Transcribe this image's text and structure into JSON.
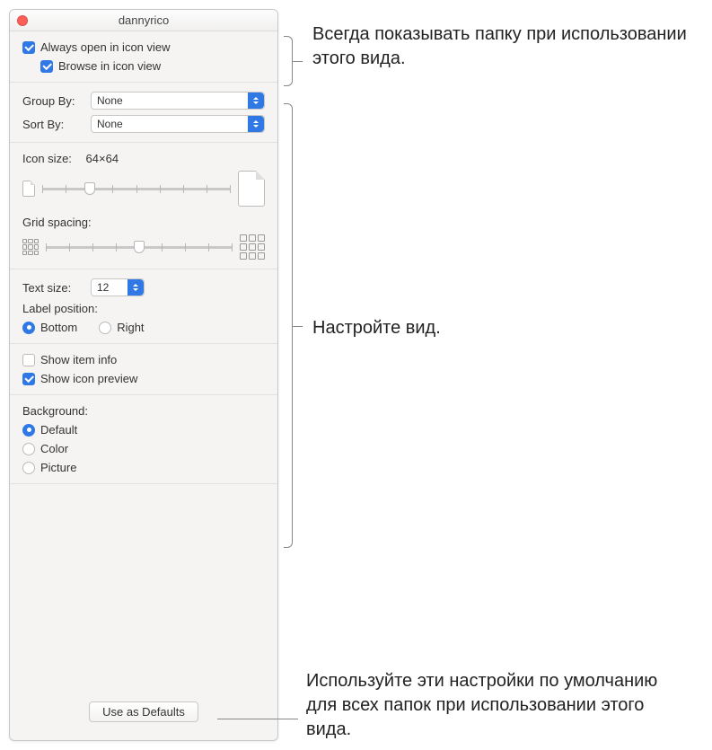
{
  "window": {
    "title": "dannyrico"
  },
  "view": {
    "always_open": "Always open in icon view",
    "browse": "Browse in icon view"
  },
  "group_sort": {
    "group_label": "Group By:",
    "group_value": "None",
    "sort_label": "Sort By:",
    "sort_value": "None"
  },
  "icon_size": {
    "label": "Icon size:",
    "value": "64×64"
  },
  "grid_spacing": {
    "label": "Grid spacing:"
  },
  "text": {
    "size_label": "Text size:",
    "size_value": "12",
    "label_position": "Label position:",
    "bottom": "Bottom",
    "right": "Right"
  },
  "info": {
    "show_item": "Show item info",
    "show_preview": "Show icon preview"
  },
  "background": {
    "heading": "Background:",
    "default": "Default",
    "color": "Color",
    "picture": "Picture"
  },
  "footer": {
    "btn": "Use as Defaults"
  },
  "annotations": {
    "top": "Всегда показывать папку при использовании этого вида.",
    "mid": "Настройте вид.",
    "bottom": "Используйте эти настройки по умолчанию для всех папок при использовании этого вида."
  }
}
